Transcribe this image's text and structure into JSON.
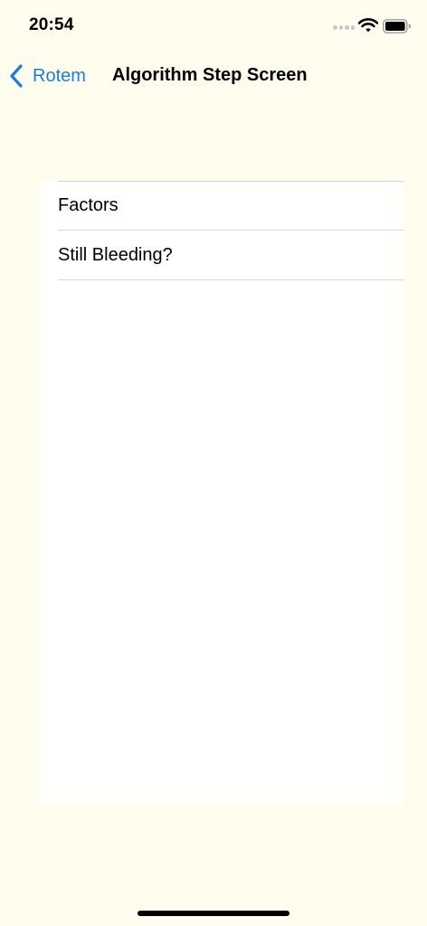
{
  "status_bar": {
    "time": "20:54",
    "icons": [
      "signal-dots-icon",
      "wifi-icon",
      "battery-icon"
    ]
  },
  "nav": {
    "back_label": "Rotem",
    "title": "Algorithm Step Screen"
  },
  "list": {
    "items": [
      {
        "label": "Factors"
      },
      {
        "label": "Still Bleeding?"
      }
    ]
  },
  "colors": {
    "background": "#FFFDEE",
    "accent": "#1F7AE0",
    "panel": "#FFFFFD"
  }
}
